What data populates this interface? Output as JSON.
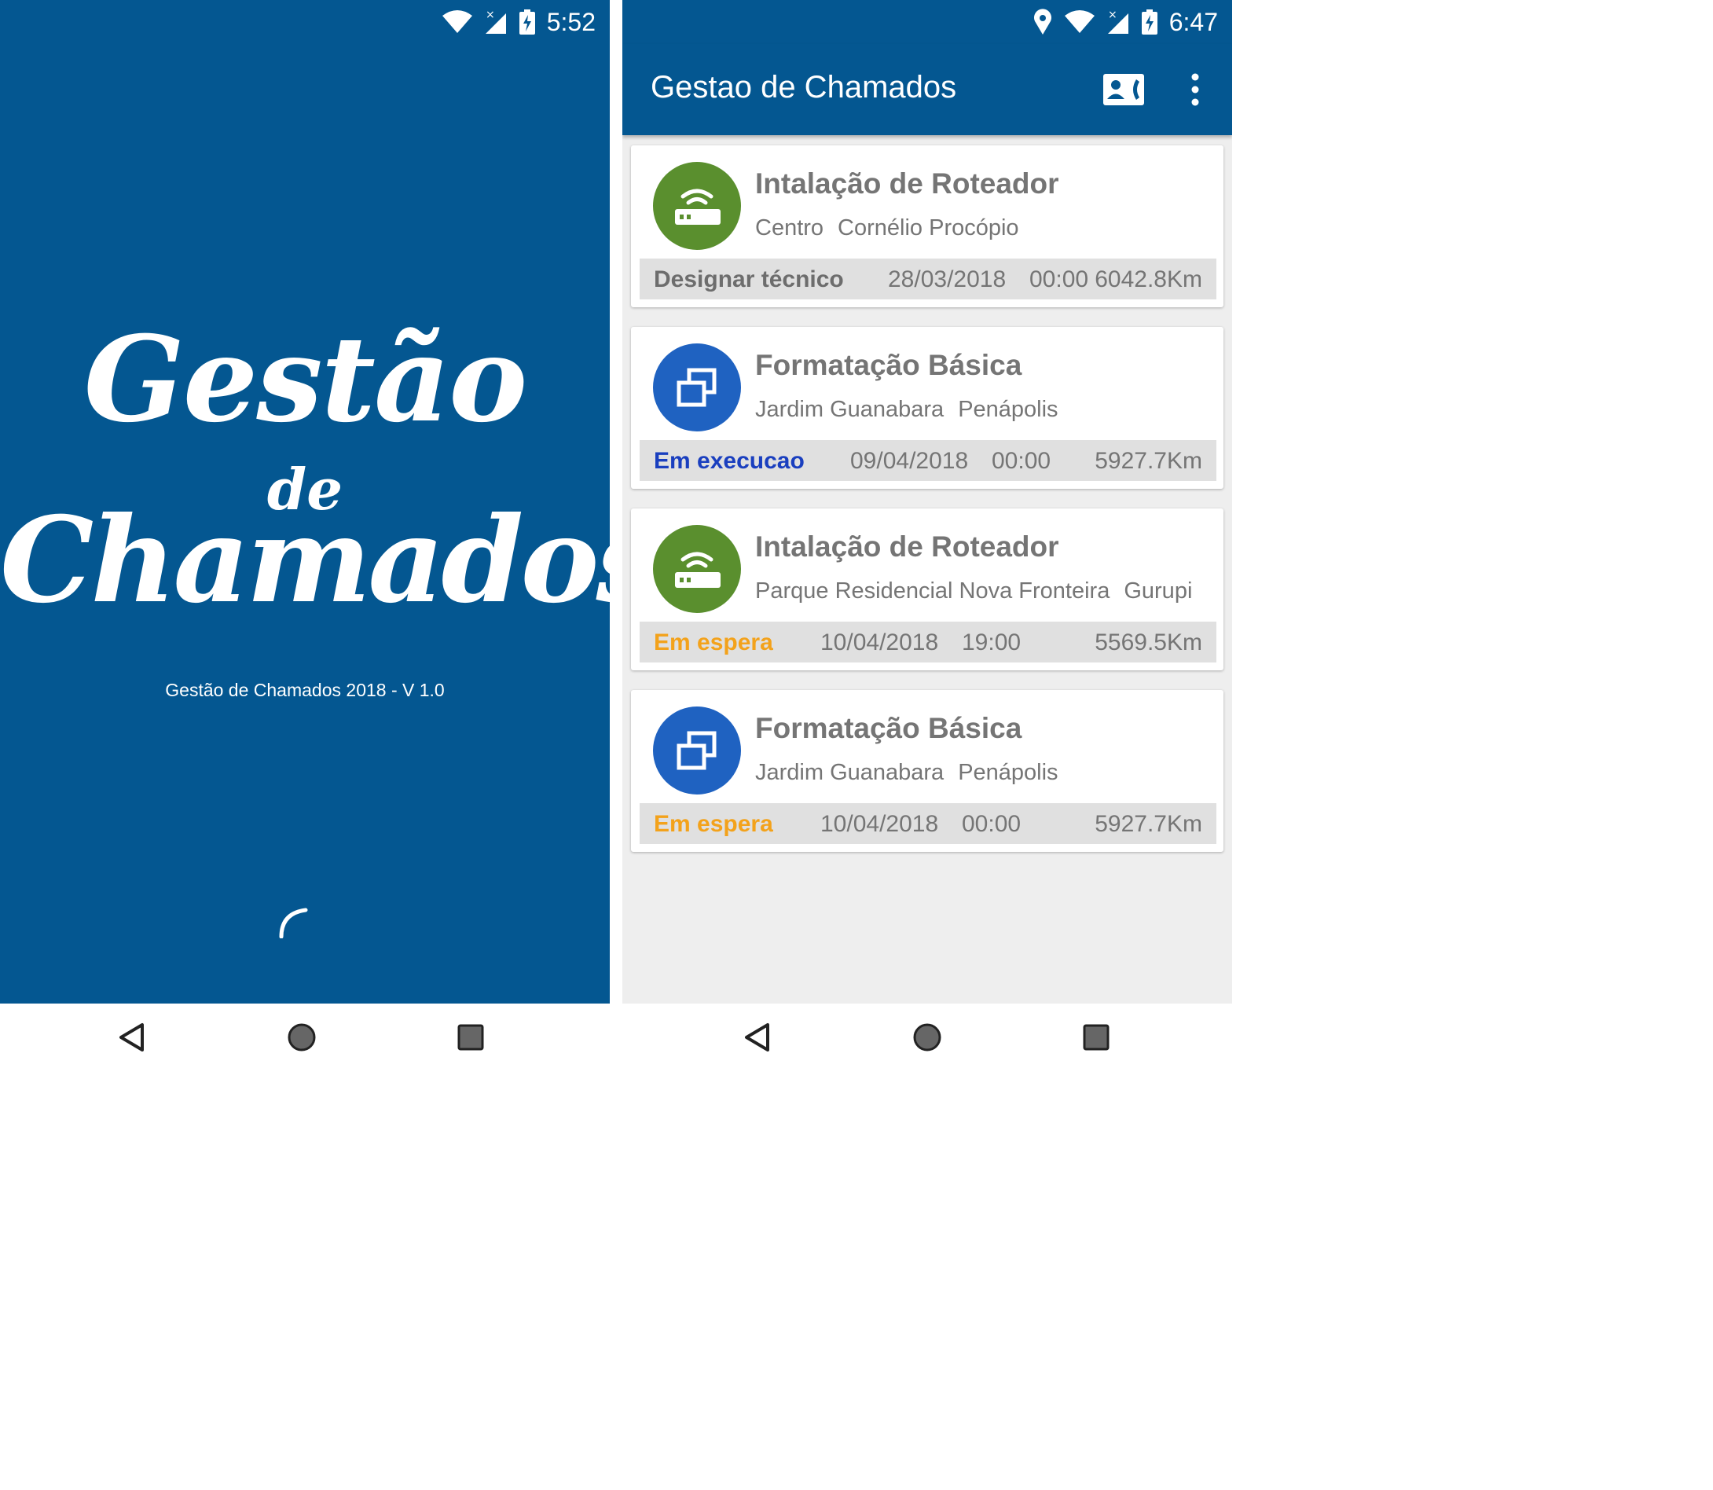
{
  "splash": {
    "status_time": "5:52",
    "logo_line1": "Gestão",
    "logo_line2": "de",
    "logo_line3": "Chamados",
    "version": "Gestão de Chamados 2018 - V 1.0"
  },
  "main": {
    "status_time": "6:47",
    "title": "Gestao de Chamados",
    "cards": [
      {
        "icon": "router-icon",
        "icon_color": "#5a8f2e",
        "title": "Intalação de Roteador",
        "neighborhood": "Centro",
        "city": "Cornélio Procópio",
        "status": "Designar técnico",
        "status_color": "#6d6d6d",
        "date": "28/03/2018",
        "time": "00:00",
        "distance": "6042.8Km"
      },
      {
        "icon": "windows-icon",
        "icon_color": "#1f62c1",
        "title": "Formatação Básica",
        "neighborhood": "Jardim Guanabara",
        "city": "Penápolis",
        "status": "Em execucao",
        "status_color": "#1a3fbf",
        "date": "09/04/2018",
        "time": "00:00",
        "distance": "5927.7Km"
      },
      {
        "icon": "router-icon",
        "icon_color": "#5a8f2e",
        "title": "Intalação de Roteador",
        "neighborhood": "Parque Residencial Nova Fronteira",
        "city": "Gurupi",
        "status": "Em espera",
        "status_color": "#f3a21b",
        "date": "10/04/2018",
        "time": "19:00",
        "distance": "5569.5Km"
      },
      {
        "icon": "windows-icon",
        "icon_color": "#1f62c1",
        "title": "Formatação Básica",
        "neighborhood": "Jardim Guanabara",
        "city": "Penápolis",
        "status": "Em espera",
        "status_color": "#f3a21b",
        "date": "10/04/2018",
        "time": "00:00",
        "distance": "5927.7Km"
      }
    ]
  },
  "colors": {
    "primary": "#045791",
    "background": "#eeeeee",
    "footer": "#e0e0e0"
  }
}
